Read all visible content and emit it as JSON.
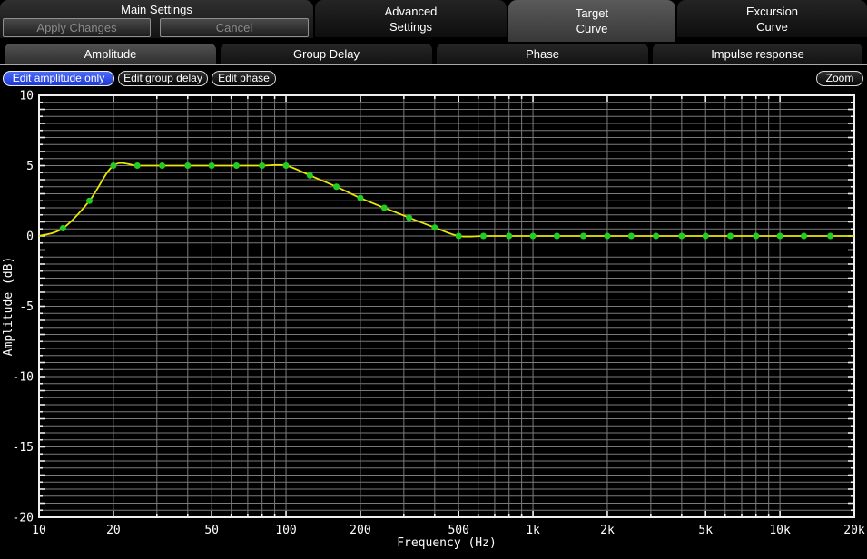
{
  "top_panel": {
    "title": "Main Settings",
    "apply": {
      "label": "Apply Changes",
      "disabled": true
    },
    "cancel": {
      "label": "Cancel",
      "disabled": true
    }
  },
  "main_tabs": [
    {
      "label": "Advanced\nSettings",
      "selected": false
    },
    {
      "label": "Target\nCurve",
      "selected": true
    },
    {
      "label": "Excursion\nCurve",
      "selected": false
    }
  ],
  "view_tabs": [
    {
      "label": "Amplitude",
      "selected": true
    },
    {
      "label": "Group Delay",
      "selected": false
    },
    {
      "label": "Phase",
      "selected": false
    },
    {
      "label": "Impulse response",
      "selected": false
    }
  ],
  "edit_buttons": [
    {
      "label": "Edit amplitude only",
      "active": true
    },
    {
      "label": "Edit group delay",
      "active": false
    },
    {
      "label": "Edit phase",
      "active": false
    }
  ],
  "zoom_button": {
    "label": "Zoom"
  },
  "chart_data": {
    "type": "line",
    "x_scale": "log",
    "xlabel": "Frequency (Hz)",
    "ylabel": "Amplitude (dB)",
    "xlim": [
      10,
      20000
    ],
    "ylim": [
      -20,
      10
    ],
    "x_tick_labels": [
      {
        "f": 10,
        "label": "10"
      },
      {
        "f": 20,
        "label": "20"
      },
      {
        "f": 50,
        "label": "50"
      },
      {
        "f": 100,
        "label": "100"
      },
      {
        "f": 200,
        "label": "200"
      },
      {
        "f": 500,
        "label": "500"
      },
      {
        "f": 1000,
        "label": "1k"
      },
      {
        "f": 2000,
        "label": "2k"
      },
      {
        "f": 5000,
        "label": "5k"
      },
      {
        "f": 10000,
        "label": "10k"
      },
      {
        "f": 20000,
        "label": "20k"
      }
    ],
    "y_tick_labels": [
      {
        "v": 10,
        "label": "10"
      },
      {
        "v": 5,
        "label": "5"
      },
      {
        "v": 0,
        "label": "0"
      },
      {
        "v": -5,
        "label": "-5"
      },
      {
        "v": -10,
        "label": "-10"
      },
      {
        "v": -15,
        "label": "-15"
      },
      {
        "v": -20,
        "label": "-20"
      }
    ],
    "grid": {
      "y_minor_step": 0.5,
      "x_minor": "decade-integer-multiples",
      "on": true
    },
    "colors": {
      "line": "#e9e900",
      "marker": "#22cc22",
      "grid": "#7a7a7a",
      "frame": "#efefef",
      "text": "#ffffff",
      "background": "#000000"
    },
    "points": [
      {
        "f": 10,
        "db": 0
      },
      {
        "f": 12.5,
        "db": 0.55
      },
      {
        "f": 16,
        "db": 2.5
      },
      {
        "f": 20,
        "db": 5
      },
      {
        "f": 25,
        "db": 5
      },
      {
        "f": 31.5,
        "db": 5
      },
      {
        "f": 40,
        "db": 5
      },
      {
        "f": 50,
        "db": 5
      },
      {
        "f": 63,
        "db": 5
      },
      {
        "f": 80,
        "db": 5
      },
      {
        "f": 100,
        "db": 5
      },
      {
        "f": 125,
        "db": 4.3
      },
      {
        "f": 160,
        "db": 3.5
      },
      {
        "f": 200,
        "db": 2.7
      },
      {
        "f": 250,
        "db": 2.0
      },
      {
        "f": 315,
        "db": 1.3
      },
      {
        "f": 400,
        "db": 0.6
      },
      {
        "f": 500,
        "db": 0
      },
      {
        "f": 630,
        "db": 0
      },
      {
        "f": 800,
        "db": 0
      },
      {
        "f": 1000,
        "db": 0
      },
      {
        "f": 1250,
        "db": 0
      },
      {
        "f": 1600,
        "db": 0
      },
      {
        "f": 2000,
        "db": 0
      },
      {
        "f": 2500,
        "db": 0
      },
      {
        "f": 3150,
        "db": 0
      },
      {
        "f": 4000,
        "db": 0
      },
      {
        "f": 5000,
        "db": 0
      },
      {
        "f": 6300,
        "db": 0
      },
      {
        "f": 8000,
        "db": 0
      },
      {
        "f": 10000,
        "db": 0
      },
      {
        "f": 12500,
        "db": 0
      },
      {
        "f": 16000,
        "db": 0
      },
      {
        "f": 20000,
        "db": 0
      }
    ]
  }
}
